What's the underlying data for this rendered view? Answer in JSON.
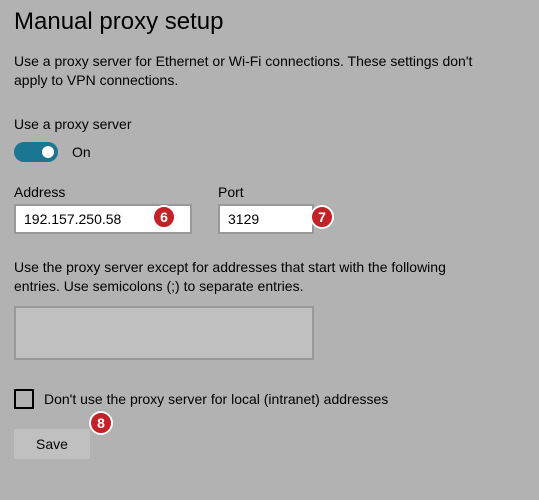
{
  "title": "Manual proxy setup",
  "description": "Use a proxy server for Ethernet or Wi-Fi connections. These settings don't apply to VPN connections.",
  "use_proxy": {
    "label": "Use a proxy server",
    "toggle_state": "On"
  },
  "address": {
    "label": "Address",
    "value": "192.157.250.58"
  },
  "port": {
    "label": "Port",
    "value": "3129"
  },
  "exceptions": {
    "text": "Use the proxy server except for addresses that start with the following entries. Use semicolons (;) to separate entries.",
    "value": ""
  },
  "bypass_local": {
    "label": "Don't use the proxy server for local (intranet) addresses",
    "checked": false
  },
  "save_label": "Save",
  "markers": {
    "m6": "6",
    "m7": "7",
    "m8": "8"
  }
}
